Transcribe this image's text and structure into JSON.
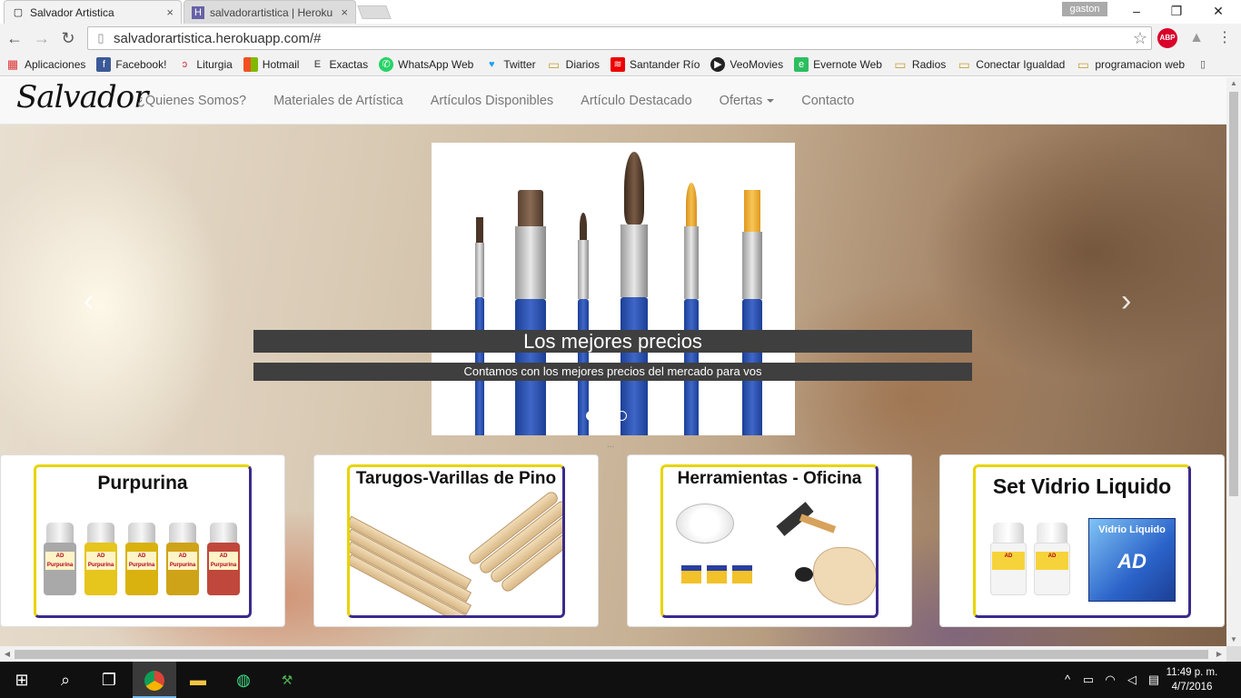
{
  "browser": {
    "tabs": [
      {
        "title": "Salvador Artistica",
        "icon": "page-icon",
        "close": "×"
      },
      {
        "title": "salvadorartistica | Heroku",
        "icon": "heroku-icon",
        "close": "×"
      }
    ],
    "profile": "gaston",
    "window_controls": {
      "minimize": "–",
      "restore": "❐",
      "close": "✕"
    },
    "url": "salvadorartistica.herokuapp.com/#",
    "abp_label": "ABP",
    "bookmarks": [
      {
        "label": "Aplicaciones",
        "icon": "apps-grid-icon"
      },
      {
        "label": "Facebook!",
        "icon": "facebook-icon"
      },
      {
        "label": "Liturgia",
        "icon": "liturgia-icon"
      },
      {
        "label": "Hotmail",
        "icon": "windows-icon"
      },
      {
        "label": "Exactas",
        "icon": "exactas-icon"
      },
      {
        "label": "WhatsApp Web",
        "icon": "whatsapp-icon"
      },
      {
        "label": "Twitter",
        "icon": "twitter-icon"
      },
      {
        "label": "Diarios",
        "icon": "folder-icon"
      },
      {
        "label": "Santander Río",
        "icon": "santander-icon"
      },
      {
        "label": "VeoMovies",
        "icon": "play-icon"
      },
      {
        "label": "Evernote Web",
        "icon": "evernote-icon"
      },
      {
        "label": "Radios",
        "icon": "folder-icon"
      },
      {
        "label": "Conectar Igualdad",
        "icon": "folder-icon"
      },
      {
        "label": "programacion web",
        "icon": "folder-icon"
      }
    ]
  },
  "site": {
    "brand": "Salvador",
    "nav": [
      {
        "label": "¿Quienes Somos?"
      },
      {
        "label": "Materiales de Artística"
      },
      {
        "label": "Artículos Disponibles"
      },
      {
        "label": "Artículo Destacado"
      },
      {
        "label": "Ofertas",
        "dropdown": true
      },
      {
        "label": "Contacto"
      }
    ],
    "carousel": {
      "title": "Los mejores precios",
      "text": "Contamos con los mejores precios del mercado para vos",
      "prev": "‹",
      "next": "›",
      "slide_count": 3,
      "active_slide": 1,
      "ellipsis": "..."
    },
    "products": [
      {
        "title": "Purpurina"
      },
      {
        "title": "Tarugos-Varillas de Pino"
      },
      {
        "title": "Herramientas - Oficina"
      },
      {
        "title": "Set Vidrio Liquido"
      }
    ],
    "product_labels": {
      "purpurina_brand": "AD",
      "purpurina_jar": "Purpurina",
      "vidrio_brand": "AD",
      "vidrio_box_title": "Vidrio Liquido"
    }
  },
  "taskbar": {
    "clock_time": "11:49 p. m.",
    "clock_date": "4/7/2016"
  },
  "colors": {
    "nav_text": "#777777",
    "caption_bg": "#3f3f3f",
    "card_border_yellow": "#e8d400",
    "card_border_purple": "#3b2a8c",
    "brush_handle": "#2b50b0"
  }
}
